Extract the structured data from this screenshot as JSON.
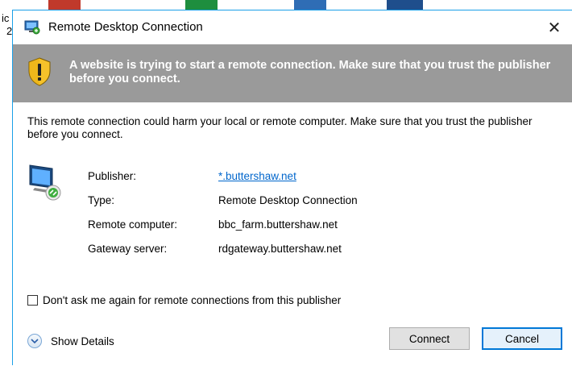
{
  "background": {
    "left_text_1": "ic",
    "left_text_2": "2"
  },
  "dialog": {
    "title": "Remote Desktop Connection",
    "close_glyph": "✕",
    "warning": "A website is trying to start a remote connection. Make sure that you trust the publisher before you connect.",
    "intro": "This remote connection could harm your local or remote computer. Make sure that you trust the publisher before you connect.",
    "details": [
      {
        "label": "Publisher:",
        "value": "*.buttershaw.net",
        "is_link": true
      },
      {
        "label": "Type:",
        "value": "Remote Desktop Connection",
        "is_link": false
      },
      {
        "label": "Remote computer:",
        "value": "bbc_farm.buttershaw.net",
        "is_link": false
      },
      {
        "label": "Gateway server:",
        "value": "rdgateway.buttershaw.net",
        "is_link": false
      }
    ],
    "dont_ask_label": "Don't ask me again for remote connections from this publisher",
    "dont_ask_checked": false,
    "show_details_label": "Show Details",
    "connect_label": "Connect",
    "cancel_label": "Cancel"
  },
  "colors": {
    "accent": "#0078d7",
    "banner": "#9a9a9a",
    "link": "#0066cc"
  },
  "icons": [
    "rdc-app-icon",
    "shield-warning-icon",
    "monitor-connection-icon",
    "chevron-down-icon",
    "close-icon"
  ]
}
